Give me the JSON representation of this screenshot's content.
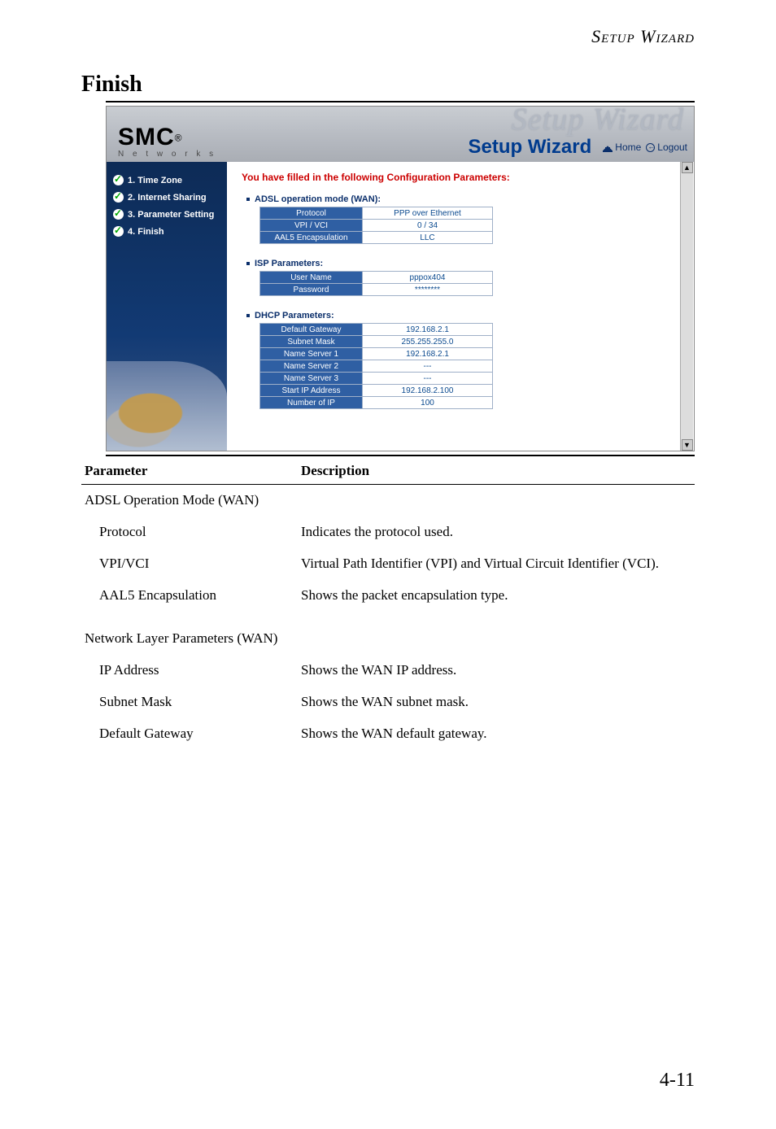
{
  "page_header": "Setup Wizard",
  "section_title": "Finish",
  "branding": {
    "logo": "SMC",
    "registered": "®",
    "tagline": "N e t w o r k s"
  },
  "banner": {
    "ghost_title": "Setup Wizard",
    "label": "Setup Wizard",
    "home": "Home",
    "logout": "Logout"
  },
  "sidebar_steps": [
    "1. Time Zone",
    "2. Internet Sharing",
    "3. Parameter Setting",
    "4. Finish"
  ],
  "confirm_header": "You have filled in the following Configuration Parameters:",
  "groups": [
    {
      "title": "ADSL operation mode (WAN):",
      "rows": [
        {
          "label": "Protocol",
          "value": "PPP over Ethernet"
        },
        {
          "label": "VPI / VCI",
          "value": "0 / 34"
        },
        {
          "label": "AAL5 Encapsulation",
          "value": "LLC"
        }
      ]
    },
    {
      "title": "ISP Parameters:",
      "rows": [
        {
          "label": "User Name",
          "value": "pppox404"
        },
        {
          "label": "Password",
          "value": "********"
        }
      ]
    },
    {
      "title": "DHCP Parameters:",
      "rows": [
        {
          "label": "Default Gateway",
          "value": "192.168.2.1"
        },
        {
          "label": "Subnet Mask",
          "value": "255.255.255.0"
        },
        {
          "label": "Name Server 1",
          "value": "192.168.2.1"
        },
        {
          "label": "Name Server 2",
          "value": "---"
        },
        {
          "label": "Name Server 3",
          "value": "---"
        },
        {
          "label": "Start IP Address",
          "value": "192.168.2.100"
        },
        {
          "label": "Number of IP",
          "value": "100"
        }
      ]
    }
  ],
  "doc_table": {
    "head_param": "Parameter",
    "head_desc": "Description",
    "rows": [
      {
        "param": "ADSL Operation Mode (WAN)",
        "desc": "",
        "indent": false
      },
      {
        "param": "Protocol",
        "desc": "Indicates the protocol used.",
        "indent": true
      },
      {
        "param": "VPI/VCI",
        "desc": "Virtual Path Identifier (VPI) and Virtual Circuit Identifier (VCI).",
        "indent": true
      },
      {
        "param": "AAL5 Encapsulation",
        "desc": "Shows the packet encapsulation type.",
        "indent": true
      },
      {
        "param": "Network Layer Parameters (WAN)",
        "desc": "",
        "indent": false,
        "spacer_before": true
      },
      {
        "param": "IP Address",
        "desc": "Shows the WAN IP address.",
        "indent": true
      },
      {
        "param": "Subnet Mask",
        "desc": "Shows the WAN subnet mask.",
        "indent": true
      },
      {
        "param": "Default Gateway",
        "desc": "Shows the WAN default gateway.",
        "indent": true
      }
    ]
  },
  "page_number": "4-11"
}
